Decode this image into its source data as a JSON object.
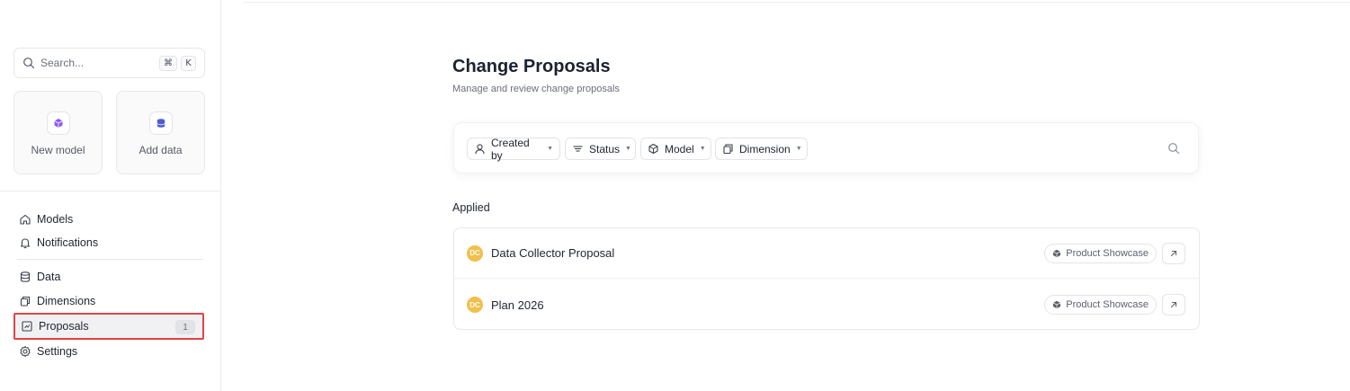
{
  "sidebar": {
    "search": {
      "placeholder": "Search...",
      "kbd_cmd": "⌘",
      "kbd_key": "K"
    },
    "tiles": [
      {
        "label": "New model",
        "icon": "cube-icon",
        "color": "#8b5cf6"
      },
      {
        "label": "Add data",
        "icon": "database-icon",
        "color": "#4f5bd5"
      }
    ],
    "nav": [
      {
        "label": "Models",
        "icon": "home-icon"
      },
      {
        "label": "Notifications",
        "icon": "bell-icon"
      },
      {
        "label": "Data",
        "icon": "database-icon"
      },
      {
        "label": "Dimensions",
        "icon": "copy-icon"
      },
      {
        "label": "Proposals",
        "icon": "proposal-icon",
        "badge": "1",
        "active": true
      },
      {
        "label": "Settings",
        "icon": "gear-icon"
      }
    ]
  },
  "main": {
    "title": "Change Proposals",
    "subtitle": "Manage and review change proposals",
    "filters": [
      {
        "label": "Created by",
        "icon": "user-icon"
      },
      {
        "label": "Status",
        "icon": "filter-lines-icon"
      },
      {
        "label": "Model",
        "icon": "cube-icon"
      },
      {
        "label": "Dimension",
        "icon": "copy-icon"
      }
    ],
    "section_label": "Applied",
    "proposals": [
      {
        "avatar": "DC",
        "title": "Data Collector Proposal",
        "tag": "Product Showcase"
      },
      {
        "avatar": "DC",
        "title": "Plan 2026",
        "tag": "Product Showcase"
      }
    ]
  },
  "colors": {
    "accent_purple": "#8b5cf6",
    "accent_blue": "#4f5bd5",
    "avatar_yellow": "#f0c04a",
    "highlight_red": "#e04545"
  }
}
